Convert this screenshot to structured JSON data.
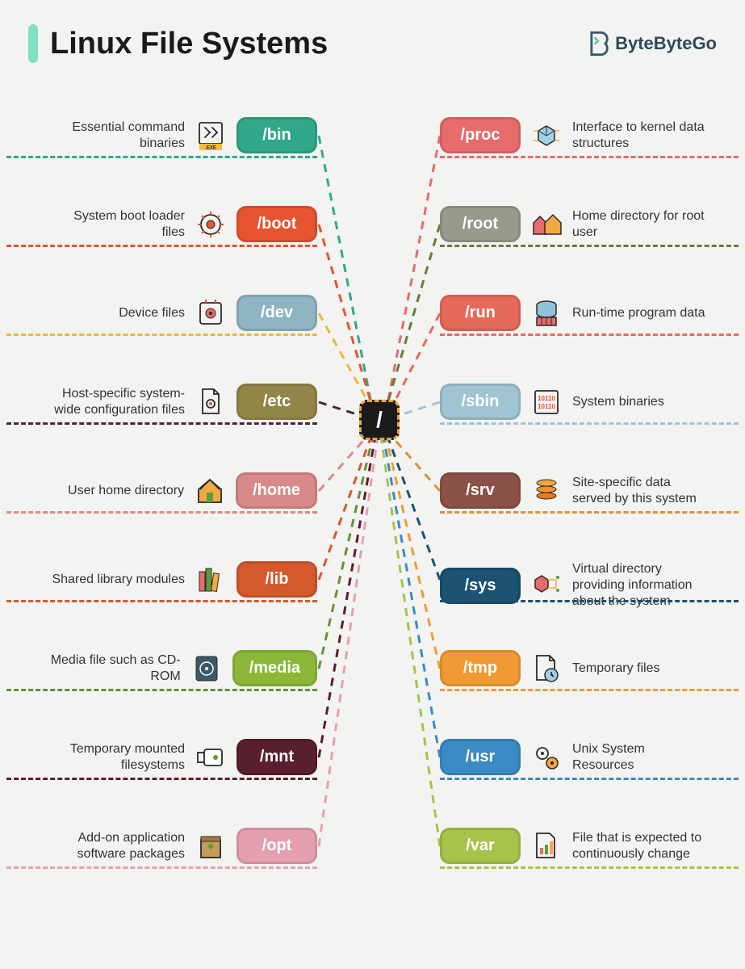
{
  "title": "Linux File Systems",
  "brand": "ByteByteGo",
  "root": "/",
  "left": [
    {
      "path": "/bin",
      "desc": "Essential command binaries",
      "color": "#31a88a",
      "icon": "exe"
    },
    {
      "path": "/boot",
      "desc": "System boot loader files",
      "color": "#e65430",
      "icon": "gear"
    },
    {
      "path": "/dev",
      "desc": "Device files",
      "color": "#8fb4c2",
      "icon": "device"
    },
    {
      "path": "/etc",
      "desc": "Host-specific system-wide configuration files",
      "color": "#938548",
      "icon": "config"
    },
    {
      "path": "/home",
      "desc": "User home directory",
      "color": "#d88a8a",
      "icon": "house"
    },
    {
      "path": "/lib",
      "desc": "Shared library modules",
      "color": "#d45a2e",
      "icon": "books"
    },
    {
      "path": "/media",
      "desc": "Media file such as CD-ROM",
      "color": "#8bb839",
      "icon": "disc"
    },
    {
      "path": "/mnt",
      "desc": "Temporary mounted filesystems",
      "color": "#5a1f2e",
      "icon": "usb"
    },
    {
      "path": "/opt",
      "desc": "Add-on application software packages",
      "color": "#e5a0b0",
      "icon": "package"
    }
  ],
  "right": [
    {
      "path": "/proc",
      "desc": "Interface to kernel data structures",
      "color": "#e66b6b",
      "icon": "kernel"
    },
    {
      "path": "/root",
      "desc": "Home directory for root user",
      "color": "#989a8e",
      "icon": "houses"
    },
    {
      "path": "/run",
      "desc": "Run-time program data",
      "color": "#e56a5a",
      "icon": "db"
    },
    {
      "path": "/sbin",
      "desc": "System binaries",
      "color": "#a0c4d1",
      "icon": "binary"
    },
    {
      "path": "/srv",
      "desc": "Site-specific data served by this system",
      "color": "#8b5147",
      "icon": "stack"
    },
    {
      "path": "/sys",
      "desc": "Virtual directory providing information about the system",
      "color": "#1a5270",
      "icon": "cube"
    },
    {
      "path": "/tmp",
      "desc": "Temporary files",
      "color": "#f09a33",
      "icon": "file-clock"
    },
    {
      "path": "/usr",
      "desc": "Unix System Resources",
      "color": "#3a8bc4",
      "icon": "gears"
    },
    {
      "path": "/var",
      "desc": "File that is expected to continuously change",
      "color": "#a6c34a",
      "icon": "chart"
    }
  ],
  "line_colors_left": [
    "#31a88a",
    "#e65430",
    "#e8b940",
    "#4a2830",
    "#d88a8a",
    "#d45a2e",
    "#6a8f3a",
    "#5a1f2e",
    "#e5a0b0"
  ],
  "line_colors_right": [
    "#e66b6b",
    "#6a7a3a",
    "#e56a5a",
    "#a0c4d1",
    "#d89040",
    "#1a5270",
    "#f09a33",
    "#3a8bc4",
    "#a6c34a"
  ]
}
